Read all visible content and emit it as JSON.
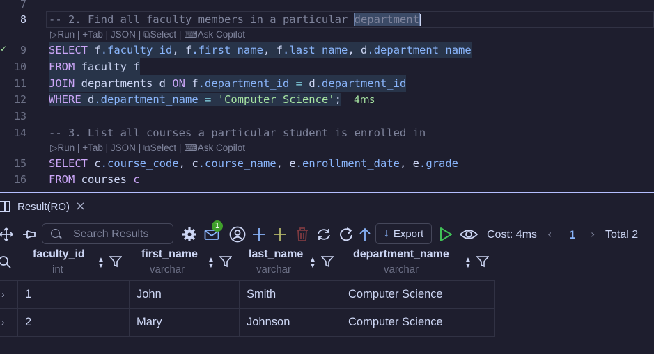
{
  "editor": {
    "lines": [
      {
        "num": "7"
      },
      {
        "num": "8",
        "comment_pre": "-- 2. Find all faculty members in a particular ",
        "comment_sel": "department"
      },
      {
        "num": "9"
      },
      {
        "num": "10"
      },
      {
        "num": "11"
      },
      {
        "num": "12"
      },
      {
        "num": "13"
      },
      {
        "num": "14",
        "comment": "-- 3. List all courses a particular student is enrolled in"
      },
      {
        "num": "15"
      },
      {
        "num": "16"
      }
    ],
    "codelens": {
      "run": "Run",
      "tab": "Tab",
      "json": "JSON",
      "select": "Select",
      "copilot": "Ask Copilot",
      "sep": "|"
    },
    "q1": {
      "l9": {
        "kw": "SELECT",
        "c1": "f",
        "c2": ".faculty_id",
        "c3": ", ",
        "c4": "f",
        "c5": ".first_name",
        "c6": ", ",
        "c7": "f",
        "c8": ".last_name",
        "c9": ", ",
        "c10": "d",
        "c11": ".department_name"
      },
      "l10": {
        "kw": "FROM",
        "rest": " faculty f"
      },
      "l11": {
        "kw": "JOIN",
        "t1": " departments d ",
        "kw2": "ON",
        "a": " f",
        "b": ".department_id",
        "eq": " = ",
        "c": "d",
        "d": ".department_id"
      },
      "l12": {
        "kw": "WHERE",
        "a": " d",
        "b": ".department_name",
        "eq": " = ",
        "str": "'Computer Science'",
        "semi": ";",
        "time": "4ms"
      }
    },
    "q2": {
      "l15": {
        "kw": "SELECT",
        "a": " c",
        "b": ".course_code",
        "s1": ", ",
        "c": "c",
        "d": ".course_name",
        "s2": ", ",
        "e": "e",
        "f": ".enrollment_date",
        "s3": ", ",
        "g": "e",
        "h": ".grade"
      },
      "l16": {
        "kw": "FROM",
        "rest": " courses ",
        "alias": "c"
      }
    }
  },
  "result": {
    "tab_label": "Result(RO)",
    "close_glyph": "×",
    "search_placeholder": "Search Results",
    "badge_count": "1",
    "export_label": "Export",
    "cost": "Cost: 4ms",
    "page": "1",
    "total": "Total 2",
    "columns": [
      {
        "name": "faculty_id",
        "type": "int"
      },
      {
        "name": "first_name",
        "type": "varchar"
      },
      {
        "name": "last_name",
        "type": "varchar"
      },
      {
        "name": "department_name",
        "type": "varchar"
      }
    ],
    "rows": [
      [
        "1",
        "John",
        "Smith",
        "Computer Science"
      ],
      [
        "2",
        "Mary",
        "Johnson",
        "Computer Science"
      ]
    ]
  },
  "colors": {
    "accent": "#89b4fa",
    "keyword": "#cba6f7",
    "string": "#a6e3a1",
    "run_green": "#40c057",
    "delete_red": "#e06c75"
  },
  "icons": [
    "move-icon",
    "pin-icon",
    "search-icon",
    "gear-icon",
    "mail-icon",
    "account-icon",
    "add-row-icon",
    "add-icon",
    "trash-icon",
    "refresh-icon",
    "reload-icon",
    "up-arrow-icon",
    "export-arrow-icon",
    "run-icon",
    "eye-icon",
    "chevron-left-icon",
    "chevron-right-icon",
    "sort-icon",
    "filter-icon",
    "row-expand-icon",
    "panel-icon",
    "close-icon"
  ]
}
